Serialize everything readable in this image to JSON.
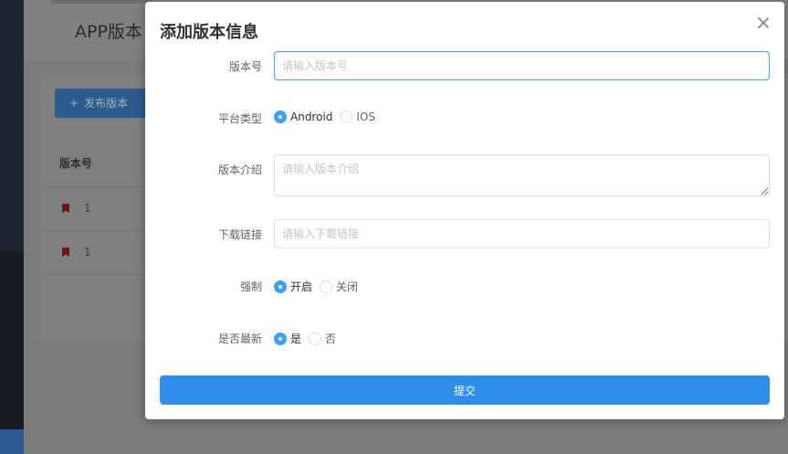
{
  "background": {
    "page_title": "APP版本",
    "publish_button": "发布版本",
    "publish_icon": "+",
    "column_header": "版本号",
    "rows": [
      "1",
      "1"
    ]
  },
  "dialog": {
    "title": "添加版本信息",
    "fields": {
      "version": {
        "label": "版本号",
        "placeholder": "请输入版本号",
        "value": ""
      },
      "platform": {
        "label": "平台类型",
        "options": [
          "Android",
          "IOS"
        ],
        "selected": "Android"
      },
      "intro": {
        "label": "版本介绍",
        "placeholder": "请输入版本介绍",
        "value": ""
      },
      "link": {
        "label": "下载链接",
        "placeholder": "请输入下载链接",
        "value": ""
      },
      "force": {
        "label": "强制",
        "options": [
          "开启",
          "关闭"
        ],
        "selected": "开启"
      },
      "latest": {
        "label": "是否最新",
        "options": [
          "是",
          "否"
        ],
        "selected": "是"
      }
    },
    "submit_label": "提交"
  },
  "colors": {
    "primary": "#409eff",
    "submit": "#2f8ceb"
  }
}
